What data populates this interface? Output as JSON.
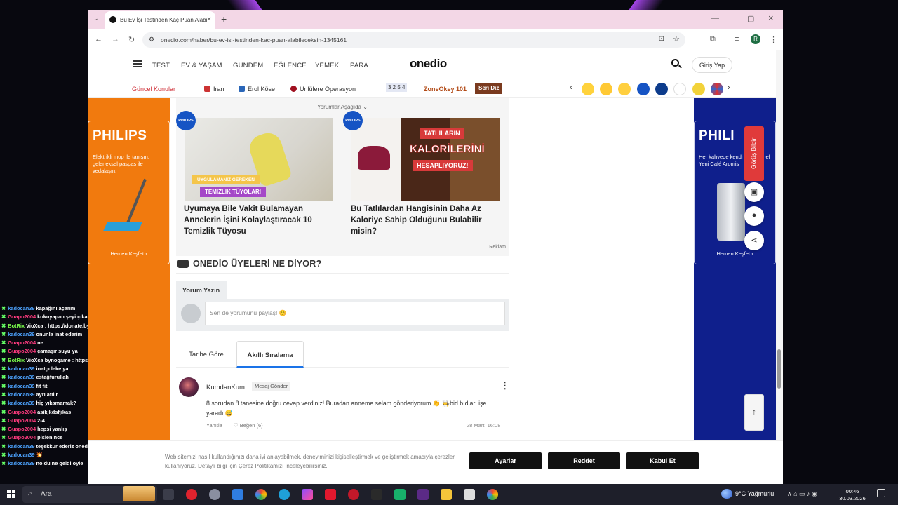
{
  "browser": {
    "tab_title": "Bu Ev İşi Testinden Kaç Puan Alabi",
    "url": "onedio.com/haber/bu-ev-isi-testinden-kac-puan-alabileceksin-1345161",
    "avatar_letter": "R"
  },
  "site": {
    "logo": "onedio",
    "nav": [
      "TEST",
      "EV & YAŞAM",
      "GÜNDEM",
      "EĞLENCE",
      "YEMEK",
      "PARA"
    ],
    "login": "Giriş Yap",
    "topics_label": "Güncel Konular",
    "topics": [
      "İran",
      "Erol Köse",
      "Ünlülere Operasyon"
    ],
    "zone_numbers": "3 2 5 4",
    "zone_label": "ZoneOkey 101",
    "seri_diz": "Seri Diz"
  },
  "ads": {
    "left": {
      "brand": "PHILIPS",
      "text": "Elektrikli mop ile tanışın, geleneksel paspas ile vedalaşın.",
      "cta": "Hemen Keşfet ›"
    },
    "right": {
      "brand": "PHILI",
      "text": "Her kahvede kendi mükemmel Yeni Café Aromis",
      "cta": "Hemen Keşfet ›"
    }
  },
  "recommendations": {
    "header": "Yorumlar Aşağıda ⌄",
    "badge": "PHILIPS",
    "items": [
      {
        "title": "Uyumaya Bile Vakit Bulamayan Annelerin İşini Kolaylaştıracak 10 Temizlik Tüyosu",
        "overlay_top": "UYGULAMANIZ GEREKEN",
        "overlay_bottom": "TEMİZLİK TÜYOLARI"
      },
      {
        "title": "Bu Tatlılardan Hangisinin Daha Az Kaloriye Sahip Olduğunu Bulabilir misin?",
        "overlay_top": "TATLILARIN",
        "overlay_mid": "KALORİLERİNİ",
        "overlay_bottom": "HESAPLIYORUZ!"
      }
    ],
    "ad_label": "Reklam"
  },
  "members": {
    "title": "ONEDİO ÜYELERİ NE DİYOR?",
    "write_tab": "Yorum Yazın",
    "placeholder": "Sen de yorumunu paylaş! 😊",
    "sort_tabs": [
      "Tarihe Göre",
      "Akıllı Sıralama"
    ]
  },
  "comment": {
    "user": "KumdanKum",
    "msg_btn": "Mesaj Gönder",
    "text": "8 sorudan 8 tanesine doğru cevap verdiniz! Buradan anneme selam gönderiyorum 👏 🧑‍🍳bid bıdları işe yaradı 😅",
    "reply": "Yanıtla",
    "like": "♡ Beğen (6)",
    "date": "28 Mart, 16:08"
  },
  "tools": {
    "feedback": "Görüş Bildir"
  },
  "cookie": {
    "text": "Web sitemizi nasıl kullandığınızı daha iyi anlayabilmek, deneyiminizi kişiselleştirmek ve geliştirmek amacıyla çerezler kullanıyoruz. Detaylı bilgi için Çerez Politikamızı inceleyebilirsiniz.",
    "settings": "Ayarlar",
    "reject": "Reddet",
    "accept": "Kabul Et"
  },
  "chat": [
    {
      "user": "kadocan39",
      "color": "#4da3ff",
      "msg": "kapağını açarım"
    },
    {
      "user": "Guapo2004",
      "color": "#ff3b7f",
      "msg": "kokuyapan şeyi çıkarmak"
    },
    {
      "user": "BotRix",
      "color": "#7cff4d",
      "msg": "VioXca : https://donate.bynogame.com/vioxca"
    },
    {
      "user": "kadocan39",
      "color": "#4da3ff",
      "msg": "onunla inat ederim"
    },
    {
      "user": "Guapo2004",
      "color": "#ff3b7f",
      "msg": "ne"
    },
    {
      "user": "Guapo2004",
      "color": "#ff3b7f",
      "msg": "çamaşır suyu ya"
    },
    {
      "user": "BotRix",
      "color": "#7cff4d",
      "msg": "VioXca bynogame : https://donate.bynogame.com/vioxca"
    },
    {
      "user": "kadocan39",
      "color": "#4da3ff",
      "msg": "inatçı leke ya"
    },
    {
      "user": "kadocan39",
      "color": "#4da3ff",
      "msg": "estağfurullah"
    },
    {
      "user": "kadocan39",
      "color": "#4da3ff",
      "msg": "fit fit"
    },
    {
      "user": "kadocan39",
      "color": "#4da3ff",
      "msg": "ayrı atılır"
    },
    {
      "user": "kadocan39",
      "color": "#4da3ff",
      "msg": "hiç yıkamamak?"
    },
    {
      "user": "Guapo2004",
      "color": "#ff3b7f",
      "msg": "asikjkdsfjıkas"
    },
    {
      "user": "Guapo2004",
      "color": "#ff3b7f",
      "msg": "2-4"
    },
    {
      "user": "Guapo2004",
      "color": "#ff3b7f",
      "msg": "hepsi yanlış"
    },
    {
      "user": "Guapo2004",
      "color": "#ff3b7f",
      "msg": "pislenince"
    },
    {
      "user": "kadocan39",
      "color": "#4da3ff",
      "msg": "teşekkür ederiz onedio"
    },
    {
      "user": "kadocan39",
      "color": "#4da3ff",
      "msg": "💥"
    },
    {
      "user": "kadocan39",
      "color": "#4da3ff",
      "msg": "noldu ne geldi öyle"
    }
  ],
  "taskbar": {
    "search": "Ara",
    "weather": "9°C  Yağmurlu",
    "time": "00:46",
    "date": "30.03.2026"
  }
}
